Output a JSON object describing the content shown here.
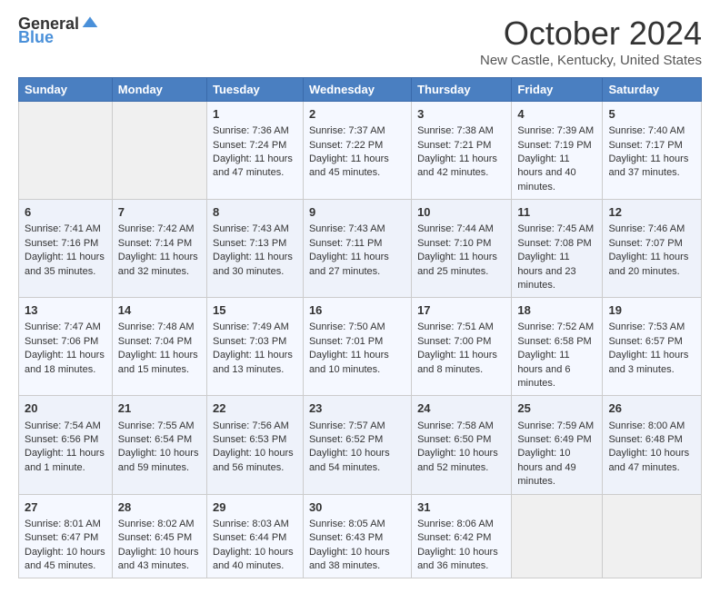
{
  "header": {
    "logo_general": "General",
    "logo_blue": "Blue",
    "month": "October 2024",
    "location": "New Castle, Kentucky, United States"
  },
  "columns": [
    "Sunday",
    "Monday",
    "Tuesday",
    "Wednesday",
    "Thursday",
    "Friday",
    "Saturday"
  ],
  "weeks": [
    [
      {
        "day": "",
        "empty": true
      },
      {
        "day": "",
        "empty": true
      },
      {
        "day": "1",
        "sunrise": "7:36 AM",
        "sunset": "7:24 PM",
        "daylight": "11 hours and 47 minutes."
      },
      {
        "day": "2",
        "sunrise": "7:37 AM",
        "sunset": "7:22 PM",
        "daylight": "11 hours and 45 minutes."
      },
      {
        "day": "3",
        "sunrise": "7:38 AM",
        "sunset": "7:21 PM",
        "daylight": "11 hours and 42 minutes."
      },
      {
        "day": "4",
        "sunrise": "7:39 AM",
        "sunset": "7:19 PM",
        "daylight": "11 hours and 40 minutes."
      },
      {
        "day": "5",
        "sunrise": "7:40 AM",
        "sunset": "7:17 PM",
        "daylight": "11 hours and 37 minutes."
      }
    ],
    [
      {
        "day": "6",
        "sunrise": "7:41 AM",
        "sunset": "7:16 PM",
        "daylight": "11 hours and 35 minutes."
      },
      {
        "day": "7",
        "sunrise": "7:42 AM",
        "sunset": "7:14 PM",
        "daylight": "11 hours and 32 minutes."
      },
      {
        "day": "8",
        "sunrise": "7:43 AM",
        "sunset": "7:13 PM",
        "daylight": "11 hours and 30 minutes."
      },
      {
        "day": "9",
        "sunrise": "7:43 AM",
        "sunset": "7:11 PM",
        "daylight": "11 hours and 27 minutes."
      },
      {
        "day": "10",
        "sunrise": "7:44 AM",
        "sunset": "7:10 PM",
        "daylight": "11 hours and 25 minutes."
      },
      {
        "day": "11",
        "sunrise": "7:45 AM",
        "sunset": "7:08 PM",
        "daylight": "11 hours and 23 minutes."
      },
      {
        "day": "12",
        "sunrise": "7:46 AM",
        "sunset": "7:07 PM",
        "daylight": "11 hours and 20 minutes."
      }
    ],
    [
      {
        "day": "13",
        "sunrise": "7:47 AM",
        "sunset": "7:06 PM",
        "daylight": "11 hours and 18 minutes."
      },
      {
        "day": "14",
        "sunrise": "7:48 AM",
        "sunset": "7:04 PM",
        "daylight": "11 hours and 15 minutes."
      },
      {
        "day": "15",
        "sunrise": "7:49 AM",
        "sunset": "7:03 PM",
        "daylight": "11 hours and 13 minutes."
      },
      {
        "day": "16",
        "sunrise": "7:50 AM",
        "sunset": "7:01 PM",
        "daylight": "11 hours and 10 minutes."
      },
      {
        "day": "17",
        "sunrise": "7:51 AM",
        "sunset": "7:00 PM",
        "daylight": "11 hours and 8 minutes."
      },
      {
        "day": "18",
        "sunrise": "7:52 AM",
        "sunset": "6:58 PM",
        "daylight": "11 hours and 6 minutes."
      },
      {
        "day": "19",
        "sunrise": "7:53 AM",
        "sunset": "6:57 PM",
        "daylight": "11 hours and 3 minutes."
      }
    ],
    [
      {
        "day": "20",
        "sunrise": "7:54 AM",
        "sunset": "6:56 PM",
        "daylight": "11 hours and 1 minute."
      },
      {
        "day": "21",
        "sunrise": "7:55 AM",
        "sunset": "6:54 PM",
        "daylight": "10 hours and 59 minutes."
      },
      {
        "day": "22",
        "sunrise": "7:56 AM",
        "sunset": "6:53 PM",
        "daylight": "10 hours and 56 minutes."
      },
      {
        "day": "23",
        "sunrise": "7:57 AM",
        "sunset": "6:52 PM",
        "daylight": "10 hours and 54 minutes."
      },
      {
        "day": "24",
        "sunrise": "7:58 AM",
        "sunset": "6:50 PM",
        "daylight": "10 hours and 52 minutes."
      },
      {
        "day": "25",
        "sunrise": "7:59 AM",
        "sunset": "6:49 PM",
        "daylight": "10 hours and 49 minutes."
      },
      {
        "day": "26",
        "sunrise": "8:00 AM",
        "sunset": "6:48 PM",
        "daylight": "10 hours and 47 minutes."
      }
    ],
    [
      {
        "day": "27",
        "sunrise": "8:01 AM",
        "sunset": "6:47 PM",
        "daylight": "10 hours and 45 minutes."
      },
      {
        "day": "28",
        "sunrise": "8:02 AM",
        "sunset": "6:45 PM",
        "daylight": "10 hours and 43 minutes."
      },
      {
        "day": "29",
        "sunrise": "8:03 AM",
        "sunset": "6:44 PM",
        "daylight": "10 hours and 40 minutes."
      },
      {
        "day": "30",
        "sunrise": "8:05 AM",
        "sunset": "6:43 PM",
        "daylight": "10 hours and 38 minutes."
      },
      {
        "day": "31",
        "sunrise": "8:06 AM",
        "sunset": "6:42 PM",
        "daylight": "10 hours and 36 minutes."
      },
      {
        "day": "",
        "empty": true
      },
      {
        "day": "",
        "empty": true
      }
    ]
  ],
  "labels": {
    "sunrise": "Sunrise:",
    "sunset": "Sunset:",
    "daylight": "Daylight:"
  }
}
